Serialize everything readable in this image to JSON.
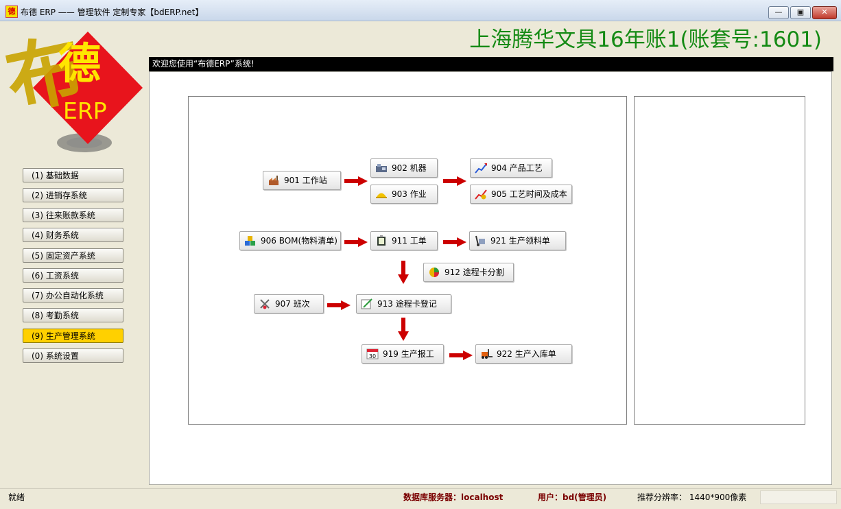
{
  "window": {
    "title": "布德 ERP —— 管理软件 定制专家【bdERP.net】",
    "icon_text": "德",
    "min_icon": "minimize-icon",
    "max_icon": "maximize-icon",
    "close_icon": "close-icon"
  },
  "company": "上海腾华文具16年账1(账套号:1601)",
  "logo": {
    "char1": "布",
    "char2": "德",
    "text": "ERP",
    "colors": {
      "diamond": "#e8141c",
      "text": "#ffe600",
      "calligraphy": "#c9a400"
    }
  },
  "nav": {
    "items": [
      {
        "label": "(1) 基础数据"
      },
      {
        "label": "(2) 进销存系统"
      },
      {
        "label": "(3) 往来账款系统"
      },
      {
        "label": "(4) 财务系统"
      },
      {
        "label": "(5) 固定资产系统"
      },
      {
        "label": "(6) 工资系统"
      },
      {
        "label": "(7) 办公自动化系统"
      },
      {
        "label": "(8) 考勤系统"
      },
      {
        "label": "(9) 生产管理系统",
        "active": true
      },
      {
        "label": "(0) 系统设置"
      }
    ]
  },
  "panel": {
    "welcome": "欢迎您使用“布德ERP”系统!"
  },
  "flow": {
    "b901": {
      "label": "901 工作站",
      "icon": "factory-icon"
    },
    "b902": {
      "label": "902 机器",
      "icon": "machine-icon"
    },
    "b903": {
      "label": "903 作业",
      "icon": "hardhat-icon"
    },
    "b904": {
      "label": "904 产品工艺",
      "icon": "chart-up-icon"
    },
    "b905": {
      "label": "905 工艺时间及成本",
      "icon": "chart-cost-icon"
    },
    "b906": {
      "label": "906 BOM(物料清单)",
      "icon": "blocks-icon"
    },
    "b911": {
      "label": "911 工单",
      "icon": "clipboard-icon"
    },
    "b921": {
      "label": "921 生产领料单",
      "icon": "handtruck-icon"
    },
    "b912": {
      "label": "912 途程卡分割",
      "icon": "pie-icon"
    },
    "b907": {
      "label": "907 班次",
      "icon": "tools-icon"
    },
    "b913": {
      "label": "913 途程卡登记",
      "icon": "edit-icon"
    },
    "b919": {
      "label": "919 生产报工",
      "icon": "calendar-icon",
      "icon_text": "30"
    },
    "b922": {
      "label": "922 生产入库单",
      "icon": "forklift-icon"
    },
    "arrow_color": "#cc0000"
  },
  "status": {
    "ready": "就绪",
    "db": "数据库服务器：localhost",
    "user": "用户：bd(管理员)",
    "resolution": "推荐分辨率： 1440*900像素"
  }
}
